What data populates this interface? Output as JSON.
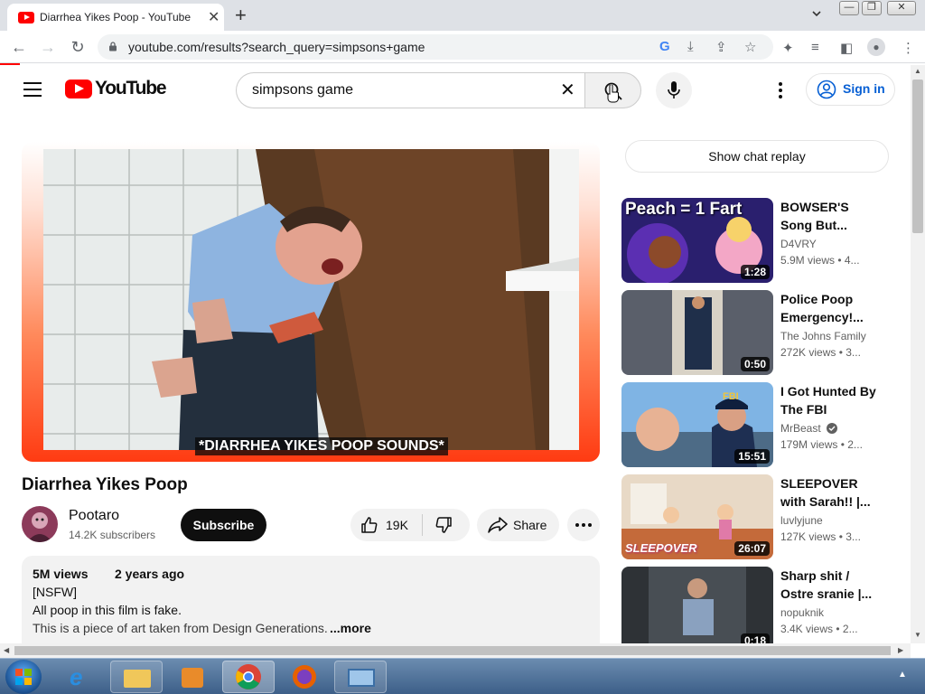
{
  "browser": {
    "tab_title": "Diarrhea Yikes Poop - YouTube",
    "url": "youtube.com/results?search_query=simpsons+game"
  },
  "header": {
    "logo_text": "YouTube",
    "search_value": "simpsons game",
    "signin_label": "Sign in"
  },
  "video": {
    "caption": "*DIARRHEA YIKES POOP SOUNDS*",
    "title": "Diarrhea Yikes Poop",
    "channel": "Pootaro",
    "subscribers": "14.2K subscribers",
    "subscribe_label": "Subscribe",
    "likes": "19K",
    "share_label": "Share"
  },
  "description": {
    "views": "5M views",
    "date": "2 years ago",
    "lines": [
      "[NSFW]",
      "All poop in this film is fake.",
      "This is a piece of art taken from Design Generations."
    ],
    "more_label": "...more"
  },
  "sidebar": {
    "chat_replay_label": "Show chat replay",
    "recommendations": [
      {
        "title": "BOWSER'S Song But...",
        "channel": "D4VRY",
        "meta": "5.9M views  • 4...",
        "duration": "1:28",
        "thumb_text": "Peach = 1 Fart",
        "verified": false
      },
      {
        "title": "Police Poop Emergency!...",
        "channel": "The Johns Family",
        "meta": "272K views  • 3...",
        "duration": "0:50",
        "thumb_text": "",
        "verified": false
      },
      {
        "title": "I Got Hunted By The FBI",
        "channel": "MrBeast",
        "meta": "179M views  • 2...",
        "duration": "15:51",
        "thumb_text": "FBI",
        "verified": true
      },
      {
        "title": "SLEEPOVER with Sarah!! |...",
        "channel": "luvlyjune",
        "meta": "127K views  • 3...",
        "duration": "26:07",
        "thumb_text": "SLEEPOVER",
        "verified": false
      },
      {
        "title": "Sharp shit / Ostre sranie |...",
        "channel": "nopuknik",
        "meta": "3.4K views  • 2...",
        "duration": "0:18",
        "thumb_text": "",
        "verified": false
      }
    ]
  },
  "colors": {
    "accent_red": "#ff0000",
    "link_blue": "#065fd4",
    "text_secondary": "#606060"
  }
}
